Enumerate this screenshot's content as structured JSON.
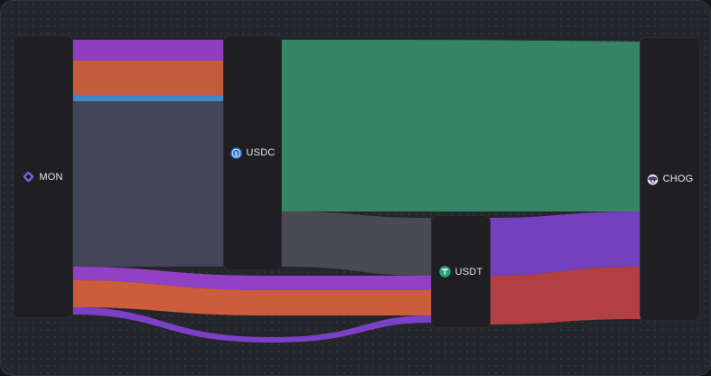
{
  "colors": {
    "bg": "#25262b",
    "node": "#1f1f23",
    "mon_accent": "#8f5cf0",
    "usdc_accent": "#2775ca",
    "usdt_accent": "#26a17b",
    "chog_accent": "#2a2a32"
  },
  "nodes": {
    "mon": {
      "label": "MON",
      "icon": "mon-diamond-icon"
    },
    "usdc": {
      "label": "USDC",
      "icon": "usdc-coin-icon"
    },
    "usdt": {
      "label": "USDT",
      "icon": "usdt-tether-icon"
    },
    "chog": {
      "label": "CHOG",
      "icon": "chog-mascot-icon"
    }
  },
  "flows": [
    {
      "source": "MON",
      "target": "USDC",
      "color": "#8e3fc0"
    },
    {
      "source": "MON",
      "target": "USDC",
      "color": "#c45c3c"
    },
    {
      "source": "MON",
      "target": "USDC",
      "color": "#3f87c9"
    },
    {
      "source": "MON",
      "target": "USDC",
      "color": "#434359"
    },
    {
      "source": "MON",
      "target": "USDT",
      "color": "#9240c4"
    },
    {
      "source": "MON",
      "target": "USDT",
      "color": "#cb5d3d"
    },
    {
      "source": "MON",
      "target": "USDT",
      "color": "#7b40c8"
    },
    {
      "source": "USDC",
      "target": "CHOG",
      "color": "#358466"
    },
    {
      "source": "USDC",
      "target": "USDT",
      "color": "#494b52"
    },
    {
      "source": "USDT",
      "target": "CHOG",
      "color": "#7440bf"
    },
    {
      "source": "USDT",
      "target": "CHOG",
      "color": "#b23f42"
    }
  ]
}
